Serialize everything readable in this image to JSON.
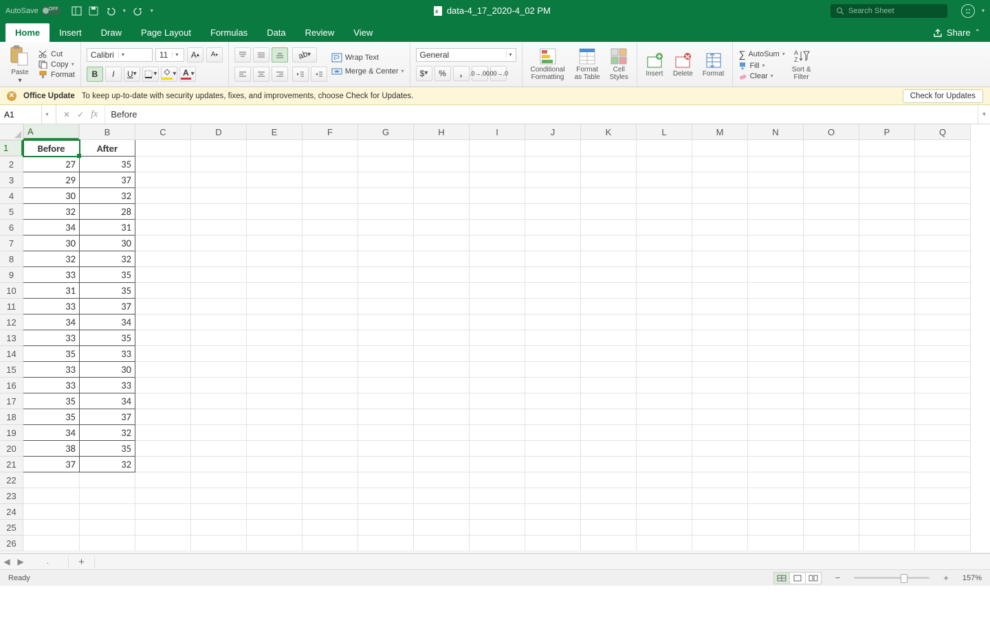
{
  "titlebar": {
    "autosave_label": "AutoSave",
    "document_title": "data-4_17_2020-4_02 PM",
    "search_placeholder": "Search Sheet"
  },
  "tabs": {
    "items": [
      "Home",
      "Insert",
      "Draw",
      "Page Layout",
      "Formulas",
      "Data",
      "Review",
      "View"
    ],
    "active": "Home",
    "share_label": "Share"
  },
  "ribbon": {
    "clipboard": {
      "paste": "Paste",
      "cut": "Cut",
      "copy": "Copy",
      "format": "Format"
    },
    "font": {
      "name": "Calibri",
      "size": "11"
    },
    "alignment": {
      "wrap": "Wrap Text",
      "merge": "Merge & Center"
    },
    "number": {
      "format": "General"
    },
    "styles": {
      "cond": "Conditional\nFormatting",
      "table": "Format\nas Table",
      "cell": "Cell\nStyles"
    },
    "cells": {
      "insert": "Insert",
      "delete": "Delete",
      "format": "Format"
    },
    "editing": {
      "autosum": "AutoSum",
      "fill": "Fill",
      "clear": "Clear",
      "sort": "Sort &\nFilter"
    }
  },
  "messagebar": {
    "title": "Office Update",
    "body": "To keep up-to-date with security updates, fixes, and improvements, choose Check for Updates.",
    "button": "Check for Updates"
  },
  "formulabar": {
    "cellref": "A1",
    "value": "Before"
  },
  "sheet": {
    "columns": [
      "A",
      "B",
      "C",
      "D",
      "E",
      "F",
      "G",
      "H",
      "I",
      "J",
      "K",
      "L",
      "M",
      "N",
      "O",
      "P",
      "Q"
    ],
    "visible_rows": 26,
    "data": {
      "headers": [
        "Before",
        "After"
      ],
      "rows": [
        [
          27,
          35
        ],
        [
          29,
          37
        ],
        [
          30,
          32
        ],
        [
          32,
          28
        ],
        [
          34,
          31
        ],
        [
          30,
          30
        ],
        [
          32,
          32
        ],
        [
          33,
          35
        ],
        [
          31,
          35
        ],
        [
          33,
          37
        ],
        [
          34,
          34
        ],
        [
          33,
          35
        ],
        [
          35,
          33
        ],
        [
          33,
          30
        ],
        [
          33,
          33
        ],
        [
          35,
          34
        ],
        [
          35,
          37
        ],
        [
          34,
          32
        ],
        [
          38,
          35
        ],
        [
          37,
          32
        ]
      ]
    },
    "active_cell": "A1",
    "tab_name": "."
  },
  "statusbar": {
    "status": "Ready",
    "zoom": "157%"
  }
}
